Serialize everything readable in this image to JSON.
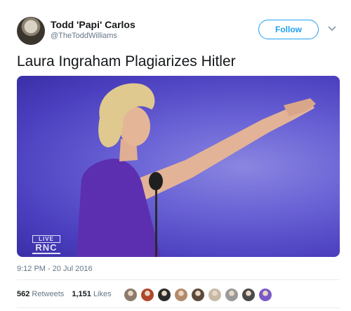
{
  "author": {
    "name": "Todd 'Papi' Carlos",
    "handle": "@TheToddWilliams",
    "avatar_icon": "statue-avatar"
  },
  "follow_label": "Follow",
  "menu_icon": "chevron-down-icon",
  "tweet": {
    "text": "Laura Ingraham Plagiarizes Hitler",
    "timestamp": "9:12 PM - 20 Jul 2016"
  },
  "media": {
    "watermark_top": "LIVE",
    "watermark_main": "RNC"
  },
  "stats": {
    "retweets_count": "562",
    "retweets_label": "Retweets",
    "likes_count": "1,151",
    "likes_label": "Likes"
  },
  "likers": [
    {
      "color": "#8c7a6b"
    },
    {
      "color": "#b0472c"
    },
    {
      "color": "#2b2b2b"
    },
    {
      "color": "#b38a6a"
    },
    {
      "color": "#5c4a3b"
    },
    {
      "color": "#c7b9a6"
    },
    {
      "color": "#9a9a9a"
    },
    {
      "color": "#4a4a4a"
    },
    {
      "color": "#7a5ac8"
    }
  ]
}
